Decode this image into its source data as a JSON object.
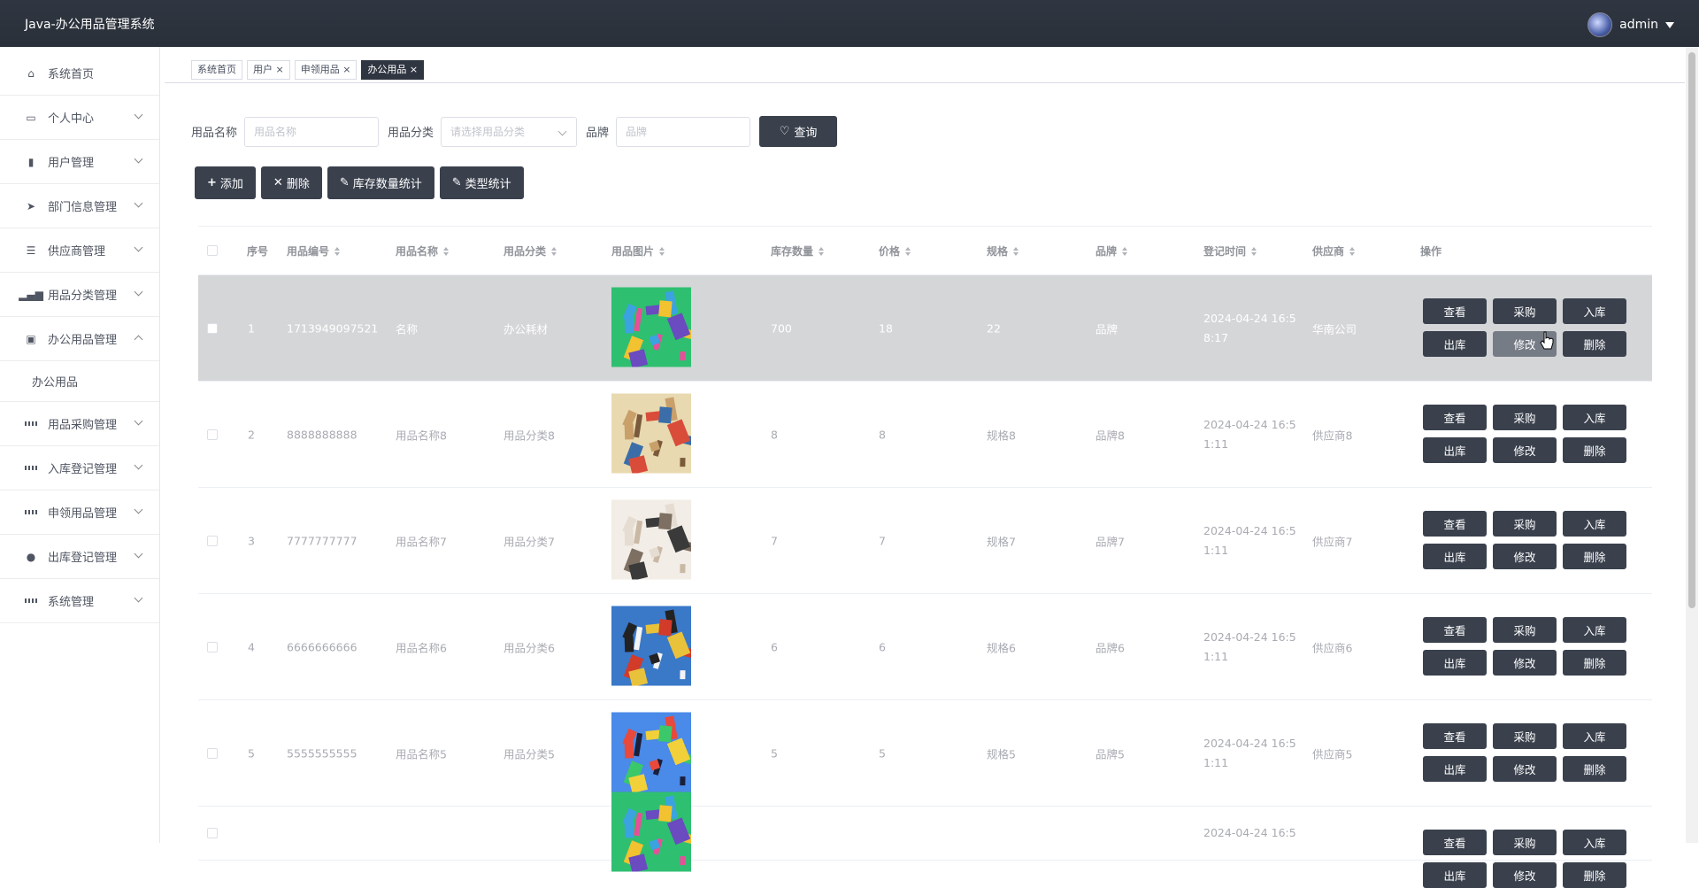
{
  "app": {
    "title": "Java-办公用品管理系统",
    "user": "admin"
  },
  "sidebar": {
    "items": [
      {
        "label": "系统首页",
        "icon": "home-icon"
      },
      {
        "label": "个人中心",
        "icon": "card-icon"
      },
      {
        "label": "用户管理",
        "icon": "flag-icon"
      },
      {
        "label": "部门信息管理",
        "icon": "send-icon"
      },
      {
        "label": "供应商管理",
        "icon": "sliders-icon"
      },
      {
        "label": "用品分类管理",
        "icon": "bar-chart-icon"
      },
      {
        "label": "办公用品管理",
        "icon": "clipboard-icon"
      },
      {
        "label": "办公用品",
        "icon": ""
      },
      {
        "label": "用品采购管理",
        "icon": "grid-icon"
      },
      {
        "label": "入库登记管理",
        "icon": "grid-icon"
      },
      {
        "label": "申领用品管理",
        "icon": "grid-icon"
      },
      {
        "label": "出库登记管理",
        "icon": "location-icon"
      },
      {
        "label": "系统管理",
        "icon": "grid-icon"
      }
    ]
  },
  "tabs": [
    {
      "label": "系统首页"
    },
    {
      "label": "用户 ×"
    },
    {
      "label": "申领用品 ×"
    },
    {
      "label": "办公用品 ×"
    }
  ],
  "search": {
    "name_label": "用品名称",
    "name_placeholder": "用品名称",
    "category_label": "用品分类",
    "category_placeholder": "请选择用品分类",
    "brand_label": "品牌",
    "brand_placeholder": "品牌",
    "query_label": "查询"
  },
  "toolbar": {
    "add": "添加",
    "delete": "删除",
    "stock_stats": "库存数量统计",
    "type_stats": "类型统计"
  },
  "table": {
    "headers": [
      "序号",
      "用品编号",
      "用品名称",
      "用品分类",
      "用品图片",
      "库存数量",
      "价格",
      "规格",
      "品牌",
      "登记时间",
      "供应商",
      "操作"
    ],
    "ops": [
      "查看",
      "采购",
      "入库",
      "出库",
      "修改",
      "删除"
    ],
    "rows": [
      {
        "seq": "1",
        "code": "1713949097521",
        "name": "名称",
        "category": "办公耗材",
        "stock": "700",
        "price": "18",
        "spec": "22",
        "brand": "品牌",
        "time1": "2024-04-24 16:5",
        "time2": "8:17",
        "supplier": "华南公司"
      },
      {
        "seq": "2",
        "code": "8888888888",
        "name": "用品名称8",
        "category": "用品分类8",
        "stock": "8",
        "price": "8",
        "spec": "规格8",
        "brand": "品牌8",
        "time1": "2024-04-24 16:5",
        "time2": "1:11",
        "supplier": "供应商8"
      },
      {
        "seq": "3",
        "code": "7777777777",
        "name": "用品名称7",
        "category": "用品分类7",
        "stock": "7",
        "price": "7",
        "spec": "规格7",
        "brand": "品牌7",
        "time1": "2024-04-24 16:5",
        "time2": "1:11",
        "supplier": "供应商7"
      },
      {
        "seq": "4",
        "code": "6666666666",
        "name": "用品名称6",
        "category": "用品分类6",
        "stock": "6",
        "price": "6",
        "spec": "规格6",
        "brand": "品牌6",
        "time1": "2024-04-24 16:5",
        "time2": "1:11",
        "supplier": "供应商6"
      },
      {
        "seq": "5",
        "code": "5555555555",
        "name": "用品名称5",
        "category": "用品分类5",
        "stock": "5",
        "price": "5",
        "spec": "规格5",
        "brand": "品牌5",
        "time1": "2024-04-24 16:5",
        "time2": "1:11",
        "supplier": "供应商5"
      },
      {
        "seq": "",
        "code": "",
        "name": "",
        "category": "",
        "stock": "",
        "price": "",
        "spec": "",
        "brand": "",
        "time1": "2024-04-24 16:5",
        "time2": "",
        "supplier": ""
      }
    ]
  },
  "colors": {
    "header_bg": "#2f3641",
    "button_bg": "#3a414d",
    "hover_row": "#d5d6d8"
  }
}
